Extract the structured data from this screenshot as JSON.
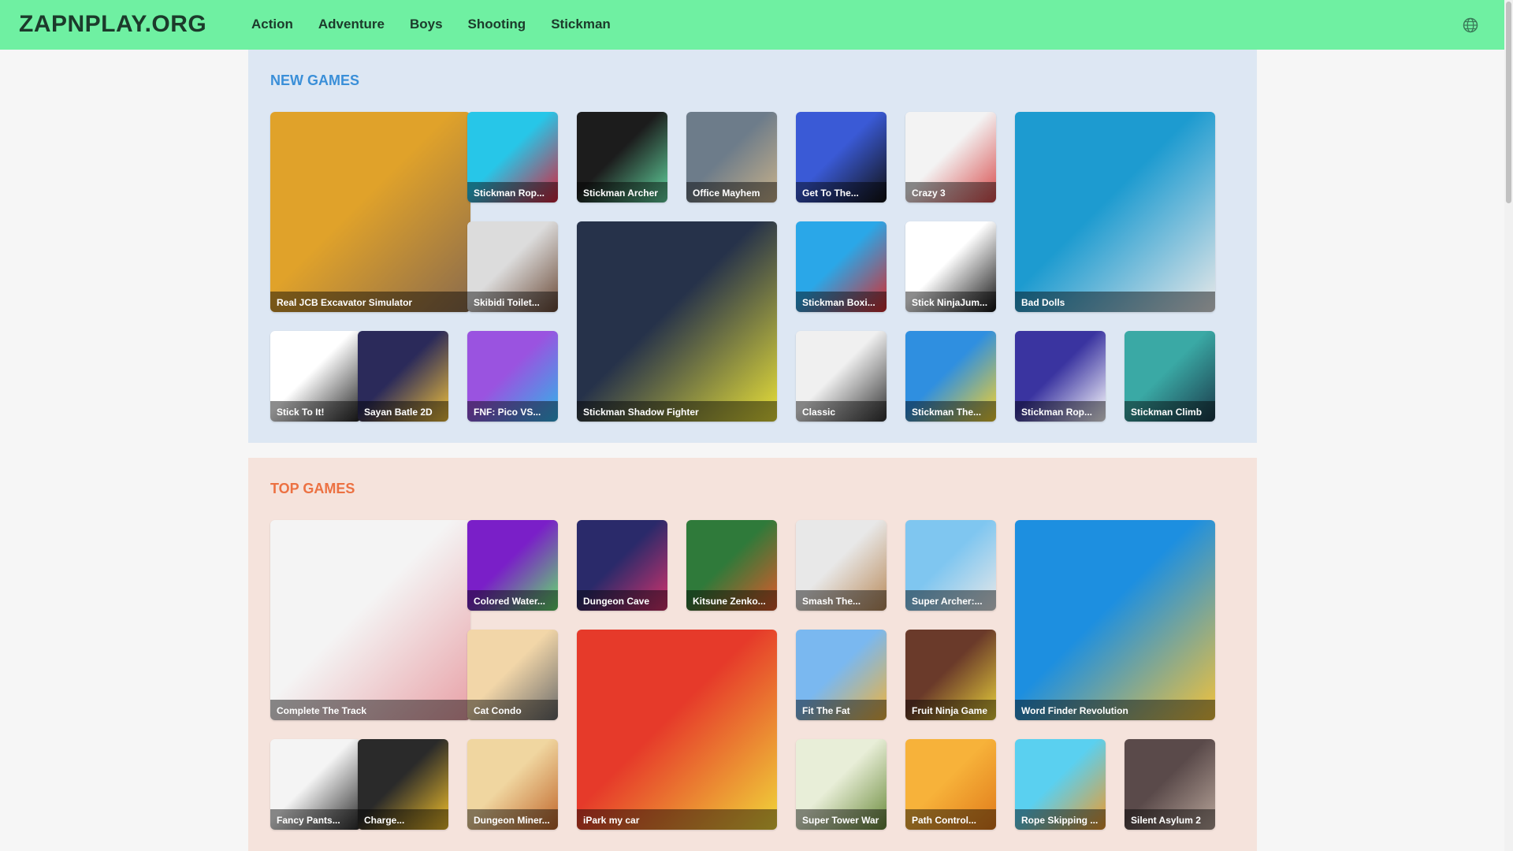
{
  "site": {
    "logo": "ZAPNPLAY.ORG",
    "nav": [
      "Action",
      "Adventure",
      "Boys",
      "Shooting",
      "Stickman"
    ]
  },
  "colors": {
    "header_bg": "#6ff0a2",
    "new_section_bg": "#dde7f3",
    "top_section_bg": "#f5e3dc",
    "new_title": "#3a8fd8",
    "top_title": "#ec7142"
  },
  "new_games": {
    "title": "NEW GAMES",
    "games": [
      {
        "title": "Real JCB Excavator Simulator",
        "art": "#e0a22a,#8a6b4d"
      },
      {
        "title": "Stickman Rop...",
        "art": "#27c6e8,#d8223b"
      },
      {
        "title": "Stickman Archer",
        "art": "#1c1c1c,#62d6a0"
      },
      {
        "title": "Office Mayhem",
        "art": "#6d7c8a,#c9b28a"
      },
      {
        "title": "Get To The...",
        "art": "#3a5ad6,#111111"
      },
      {
        "title": "Crazy 3",
        "art": "#f3f3f3,#d84b4b"
      },
      {
        "title": "Bad Dolls",
        "art": "#1d9bd0,#e8e8e8"
      },
      {
        "title": "Skibidi Toilet...",
        "art": "#dcdcdc,#6b4a37"
      },
      {
        "title": "Stickman Shadow Fighter",
        "art": "#26324a,#e8e038"
      },
      {
        "title": "Stickman Boxi...",
        "art": "#2aa7e8,#d92b2b"
      },
      {
        "title": "Stick NinjaJum...",
        "art": "#ffffff,#111111"
      },
      {
        "title": "Stick To It!",
        "art": "#ffffff,#222222"
      },
      {
        "title": "Sayan Batle 2D",
        "art": "#2b2a5a,#f2c23a"
      },
      {
        "title": "FNF: Pico VS...",
        "art": "#9a53e0,#2fb5e8"
      },
      {
        "title": "Classic",
        "art": "#f0f0f0,#333333"
      },
      {
        "title": "Stickman The...",
        "art": "#2f8fe0,#f7d22b"
      },
      {
        "title": "Stickman Rop...",
        "art": "#3a34a0,#ffffff"
      },
      {
        "title": "Stickman Climb",
        "art": "#3aa9a5,#1b3a4a"
      }
    ]
  },
  "top_games": {
    "title": "TOP GAMES",
    "games": [
      {
        "title": "Complete The Track",
        "art": "#f4f4f4,#e8a0a6"
      },
      {
        "title": "Colored Water...",
        "art": "#7a1fc8,#63e06a"
      },
      {
        "title": "Dungeon Cave",
        "art": "#2a2a6a,#d6336c"
      },
      {
        "title": "Kitsune Zenko...",
        "art": "#2f7a3a,#e05a2a"
      },
      {
        "title": "Smash The...",
        "art": "#e8e8e8,#b98a5a"
      },
      {
        "title": "Super Archer:...",
        "art": "#7fc6f0,#e8e8e8"
      },
      {
        "title": "Word Finder Revolution",
        "art": "#1d8fe0,#f3c23a"
      },
      {
        "title": "Cat Condo",
        "art": "#f2d6a8,#6b6b6b"
      },
      {
        "title": "iPark my car",
        "art": "#e63a2a,#f0d63a"
      },
      {
        "title": "Fit The Fat",
        "art": "#7ab8f0,#f0b23a"
      },
      {
        "title": "Fruit Ninja Game",
        "art": "#6a3a2a,#e8d03a"
      },
      {
        "title": "Fancy Pants...",
        "art": "#f4f4f4,#2a2a2a"
      },
      {
        "title": "Charge...",
        "art": "#2a2a2a,#f2c02a"
      },
      {
        "title": "Dungeon Miner...",
        "art": "#f0d6a0,#c0662a"
      },
      {
        "title": "Super Tower War",
        "art": "#e8eed8,#6a8a3a"
      },
      {
        "title": "Path Control...",
        "art": "#f7b23a,#e07a1a"
      },
      {
        "title": "Rope Skipping ...",
        "art": "#5ad0f0,#f09a2a"
      },
      {
        "title": "Silent Asylum 2",
        "art": "#5a4a4a,#b8a59a"
      }
    ]
  }
}
